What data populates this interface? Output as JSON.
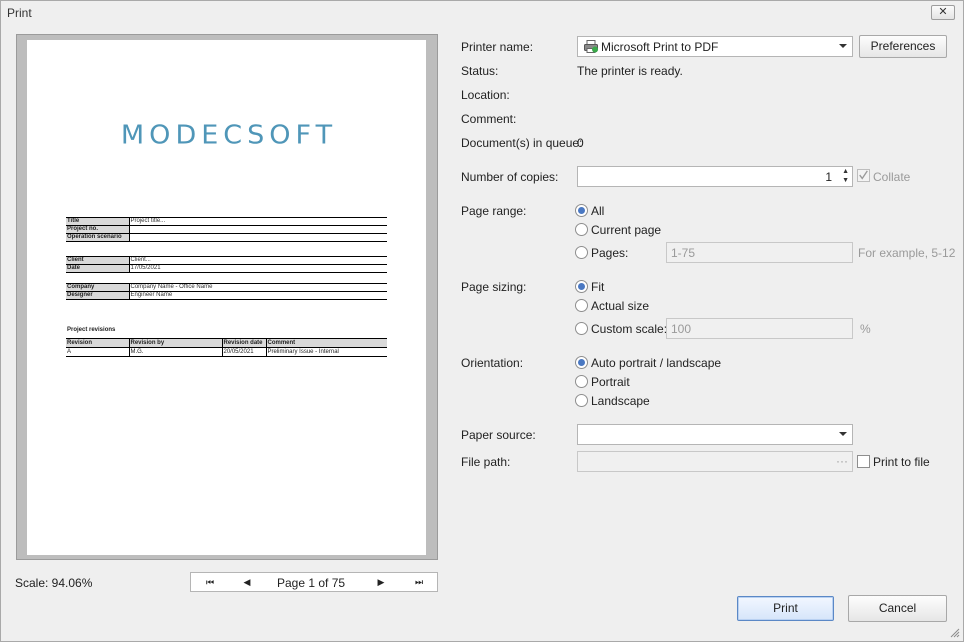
{
  "window": {
    "title": "Print",
    "close_glyph": "✕"
  },
  "preview": {
    "logo": "MODECSOFT",
    "info_table_1": [
      {
        "label": "Title",
        "value": "Project title..."
      },
      {
        "label": "Project no.",
        "value": ""
      },
      {
        "label": "Operation scenario",
        "value": ""
      }
    ],
    "info_table_2": [
      {
        "label": "Client",
        "value": "Client..."
      },
      {
        "label": "Date",
        "value": "17/05/2021"
      }
    ],
    "info_table_3": [
      {
        "label": "Company",
        "value": "Company Name - Office Name"
      },
      {
        "label": "Designer",
        "value": "Engineer Name"
      }
    ],
    "revisions_title": "Project revisions",
    "revisions_headers": [
      "Revision",
      "Revision by",
      "Revision date",
      "Comment"
    ],
    "revisions_rows": [
      [
        "A",
        "M.G.",
        "20/05/2021",
        "Preliminary Issue - Internal"
      ]
    ],
    "scale_text": "Scale: 94.06%",
    "page_info": "Page 1 of 75",
    "nav_icons": [
      "first-page-icon",
      "prev-page-icon",
      "next-page-icon",
      "last-page-icon"
    ]
  },
  "printer": {
    "name_label": "Printer name:",
    "name_value": "Microsoft Print to PDF",
    "preferences_label": "Preferences",
    "status_label": "Status:",
    "status_value": "The printer is ready.",
    "location_label": "Location:",
    "comment_label": "Comment:",
    "queue_label": "Document(s) in queue:",
    "queue_value": "0"
  },
  "copies": {
    "label": "Number of copies:",
    "value": "1",
    "collate_label": "Collate",
    "collate_checked": true
  },
  "page_range": {
    "label": "Page range:",
    "options": [
      "All",
      "Current page",
      "Pages:"
    ],
    "selected": "All",
    "pages_value": "1-75",
    "hint": "For example, 5-12"
  },
  "page_sizing": {
    "label": "Page sizing:",
    "options": [
      "Fit",
      "Actual size",
      "Custom scale:"
    ],
    "selected": "Fit",
    "scale_value": "100",
    "scale_unit": "%"
  },
  "orientation": {
    "label": "Orientation:",
    "options": [
      "Auto portrait / landscape",
      "Portrait",
      "Landscape"
    ],
    "selected": "Auto portrait / landscape"
  },
  "paper_source": {
    "label": "Paper source:",
    "value": ""
  },
  "file_path": {
    "label": "File path:",
    "value": "",
    "browse_glyph": "···",
    "print_to_file_label": "Print to file"
  },
  "actions": {
    "print_label": "Print",
    "cancel_label": "Cancel"
  },
  "colors": {
    "accent": "#4a78c2",
    "logo": "#4f96b8"
  }
}
